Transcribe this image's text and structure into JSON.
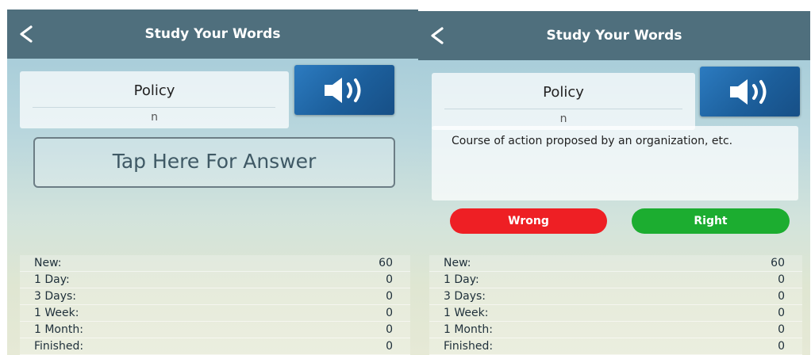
{
  "header": {
    "title": "Study Your Words"
  },
  "card": {
    "word": "Policy",
    "part_of_speech": "n"
  },
  "left": {
    "answer_button": "Tap Here For Answer"
  },
  "right": {
    "definition": "Course of action proposed by an organization, etc.",
    "wrong_label": "Wrong",
    "right_label": "Right"
  },
  "stats": [
    {
      "label": "New:",
      "value": "60"
    },
    {
      "label": "1 Day:",
      "value": "0"
    },
    {
      "label": "3 Days:",
      "value": "0"
    },
    {
      "label": "1 Week:",
      "value": "0"
    },
    {
      "label": "1 Month:",
      "value": "0"
    },
    {
      "label": "Finished:",
      "value": "0"
    }
  ],
  "colors": {
    "header": "#4f6f7d",
    "wrong": "#ee1f24",
    "right": "#1cad30",
    "speaker": "#1c5f9c"
  },
  "icons": {
    "back": "chevron-left-icon",
    "audio": "speaker-icon"
  }
}
